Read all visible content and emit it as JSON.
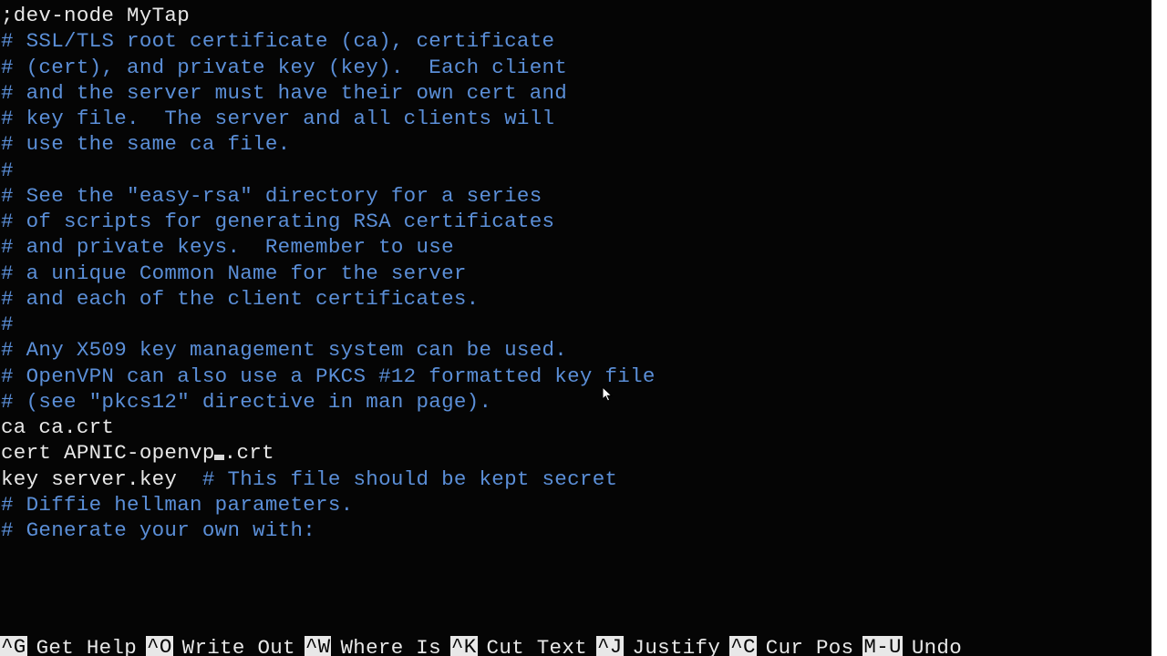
{
  "editor": {
    "lines": [
      {
        "type": "plain",
        "text": ";dev-node MyTap"
      },
      {
        "type": "plain",
        "text": ""
      },
      {
        "type": "comment",
        "text": "# SSL/TLS root certificate (ca), certificate"
      },
      {
        "type": "comment",
        "text": "# (cert), and private key (key).  Each client"
      },
      {
        "type": "comment",
        "text": "# and the server must have their own cert and"
      },
      {
        "type": "comment",
        "text": "# key file.  The server and all clients will"
      },
      {
        "type": "comment",
        "text": "# use the same ca file."
      },
      {
        "type": "comment",
        "text": "#"
      },
      {
        "type": "comment",
        "text": "# See the \"easy-rsa\" directory for a series"
      },
      {
        "type": "comment",
        "text": "# of scripts for generating RSA certificates"
      },
      {
        "type": "comment",
        "text": "# and private keys.  Remember to use"
      },
      {
        "type": "comment",
        "text": "# a unique Common Name for the server"
      },
      {
        "type": "comment",
        "text": "# and each of the client certificates."
      },
      {
        "type": "comment",
        "text": "#"
      },
      {
        "type": "comment",
        "text": "# Any X509 key management system can be used."
      },
      {
        "type": "comment",
        "text": "# OpenVPN can also use a PKCS #12 formatted key file"
      },
      {
        "type": "comment",
        "text": "# (see \"pkcs12\" directive in man page)."
      },
      {
        "type": "plain",
        "text": "ca ca.crt"
      },
      {
        "type": "mixed",
        "pre": "cert APNIC-openvp",
        "cursor": true,
        "post": ".crt",
        "comment": ""
      },
      {
        "type": "mixed",
        "pre": "key server.key  ",
        "comment": "# This file should be kept secret"
      },
      {
        "type": "plain",
        "text": ""
      },
      {
        "type": "comment",
        "text": "# Diffie hellman parameters."
      },
      {
        "type": "comment",
        "text": "# Generate your own with:"
      }
    ]
  },
  "shortcuts": [
    {
      "key": "^G",
      "label": "Get Help"
    },
    {
      "key": "^O",
      "label": "Write Out"
    },
    {
      "key": "^W",
      "label": "Where Is"
    },
    {
      "key": "^K",
      "label": "Cut Text"
    },
    {
      "key": "^J",
      "label": "Justify"
    },
    {
      "key": "^C",
      "label": "Cur Pos"
    },
    {
      "key": "M-U",
      "label": "Undo"
    }
  ]
}
